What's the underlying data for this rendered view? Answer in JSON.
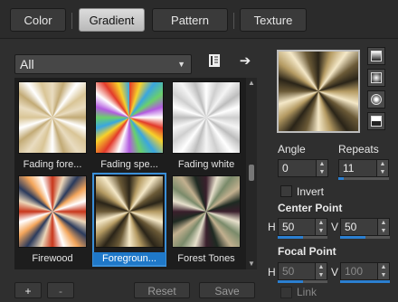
{
  "tabs": [
    {
      "label": "Color",
      "active": false
    },
    {
      "label": "Gradient",
      "active": true
    },
    {
      "label": "Pattern",
      "active": false
    },
    {
      "label": "Texture",
      "active": false
    }
  ],
  "category": {
    "selected": "All"
  },
  "icons": {
    "library": "library-icon",
    "apply": "arrow-right-icon",
    "dropdown": "chevron-down-icon"
  },
  "gradients": [
    {
      "label": "Fading fore...",
      "selected": false,
      "colors": [
        "#e9dcc0",
        "#c2aa75",
        "#ffffff",
        "#d9c596"
      ]
    },
    {
      "label": "Fading spe...",
      "selected": false,
      "colors": [
        "#e23a2a",
        "#f7d12a",
        "#3aa6e0",
        "#6bd06b",
        "#b35be0",
        "#ffffff"
      ]
    },
    {
      "label": "Fading white",
      "selected": false,
      "colors": [
        "#ffffff",
        "#cfcfcf",
        "#f4f4f4",
        "#bdbdbd"
      ]
    },
    {
      "label": "Firewood",
      "selected": false,
      "colors": [
        "#c8361b",
        "#ecd6b8",
        "#2a3a5c",
        "#f3a55b",
        "#ffffff"
      ]
    },
    {
      "label": "Foregroun...",
      "selected": true,
      "colors": [
        "#2a2418",
        "#b49a62",
        "#f4e8c8",
        "#6b5a37"
      ]
    },
    {
      "label": "Forest Tones",
      "selected": false,
      "colors": [
        "#3a1f2c",
        "#e7e0cc",
        "#7a8a6a",
        "#c2b08f",
        "#1e2a22"
      ]
    }
  ],
  "buttons": {
    "add": "+",
    "remove": "-",
    "reset": "Reset",
    "save": "Save"
  },
  "preview_colors": [
    "#2a2418",
    "#b49a62",
    "#f4e8c8",
    "#6b5a37"
  ],
  "style_buttons": [
    "linear-style-icon",
    "rectangular-style-icon",
    "sunburst-style-icon",
    "radial-style-icon"
  ],
  "angle": {
    "label": "Angle",
    "value": "0"
  },
  "repeats": {
    "label": "Repeats",
    "value": "11",
    "level": 0.1
  },
  "invert": {
    "label": "Invert",
    "checked": false
  },
  "center_point": {
    "label": "Center Point",
    "h_label": "H",
    "h": "50",
    "v_label": "V",
    "v": "50",
    "h_level": 0.5,
    "v_level": 0.5
  },
  "focal_point": {
    "label": "Focal Point",
    "h_label": "H",
    "h": "50",
    "v_label": "V",
    "v": "100",
    "h_level": 0.5,
    "v_level": 1.0
  },
  "link": {
    "label": "Link",
    "checked": false
  }
}
